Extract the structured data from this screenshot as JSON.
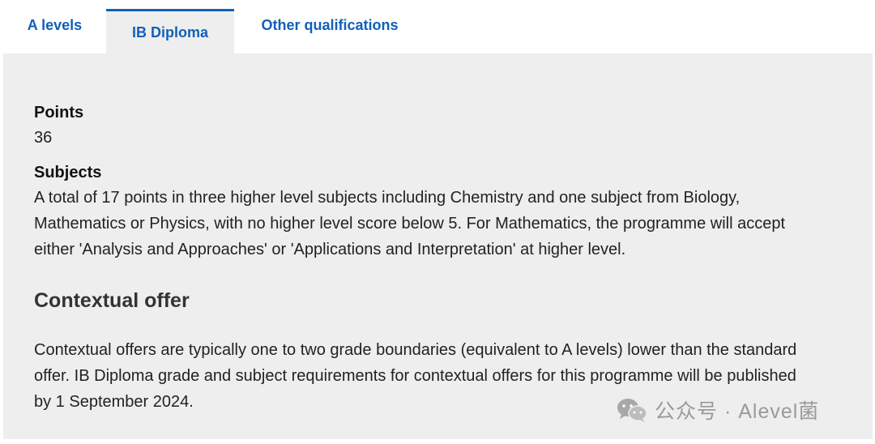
{
  "tabs": [
    {
      "label": "A levels",
      "active": false
    },
    {
      "label": "IB Diploma",
      "active": true
    },
    {
      "label": "Other qualifications",
      "active": false
    }
  ],
  "points": {
    "label": "Points",
    "value": "36"
  },
  "subjects": {
    "label": "Subjects",
    "lines": [
      "A total of 17 points in three higher level subjects including Chemistry and one subject from Biology,",
      "Mathematics or Physics, with no higher level score below 5. For Mathematics, the programme will accept",
      "either 'Analysis and Approaches' or 'Applications and Interpretation' at higher level."
    ]
  },
  "contextual": {
    "heading": "Contextual offer",
    "lines": [
      "Contextual offers are typically one to two grade boundaries (equivalent to A levels) lower than the standard",
      "offer. IB Diploma grade and subject requirements for contextual offers for this programme will be published",
      "by 1 September 2024."
    ]
  },
  "watermark": {
    "text": "公众号 · Alevel菌",
    "icon": "wechat-icon"
  },
  "colors": {
    "tab_text": "#1160b8",
    "active_border": "#1160b8",
    "panel_bg": "#eeeeee"
  }
}
